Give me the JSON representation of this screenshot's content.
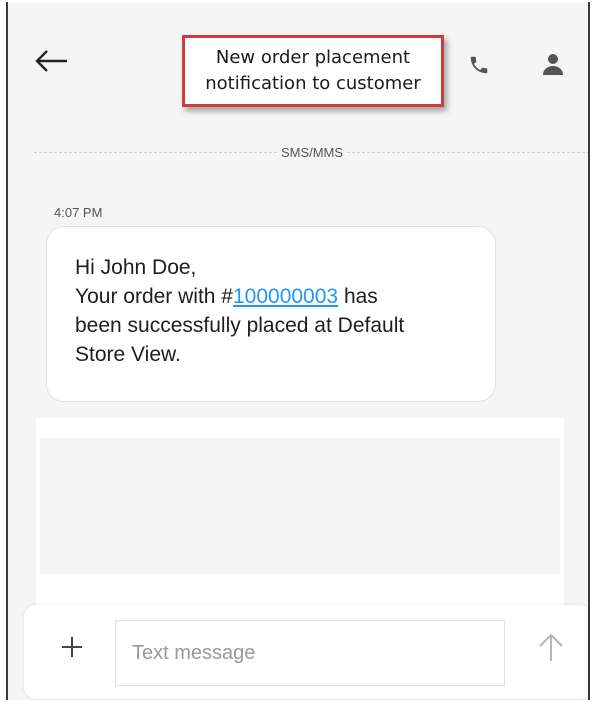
{
  "header": {
    "back_icon": "arrow-left-icon",
    "callout": {
      "line1": "New order placement",
      "line2": "notification to customer"
    },
    "call_icon": "phone-icon",
    "contact_icon": "person-icon"
  },
  "thread": {
    "channel_label": "SMS/MMS",
    "timestamp": "4:07 PM",
    "message": {
      "greeting": "Hi John Doe,",
      "prefix": "Your order with #",
      "order_number": "100000003",
      "suffix_line1": " has",
      "line2": "been successfully placed at Default",
      "line3": "Store View."
    }
  },
  "composer": {
    "add_icon": "plus-icon",
    "placeholder": "Text message",
    "value": "",
    "send_icon": "arrow-up-icon"
  },
  "colors": {
    "callout_border": "#d43a3a",
    "link": "#2196f3",
    "background": "#f5f5f5"
  }
}
